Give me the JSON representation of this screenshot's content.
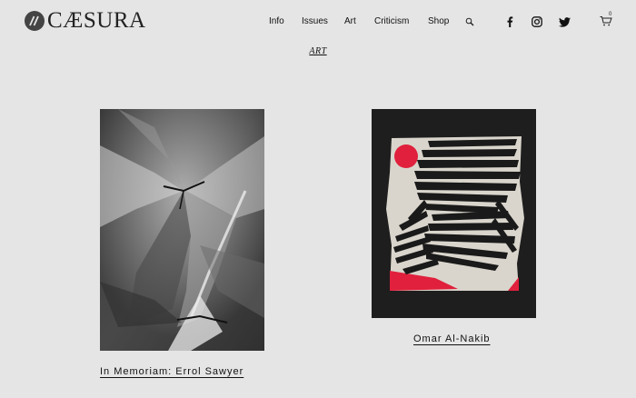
{
  "brand": {
    "name": "CÆSURA",
    "mark_text": "//"
  },
  "nav": {
    "items": [
      "Info",
      "Issues",
      "Art",
      "Criticism",
      "Shop"
    ]
  },
  "icons": [
    "search-icon",
    "facebook-icon",
    "instagram-icon",
    "twitter-icon",
    "cart-icon"
  ],
  "cart": {
    "count": "0"
  },
  "section": {
    "label": "ART"
  },
  "articles": [
    {
      "title": "In Memoriam: Errol Sawyer",
      "image": "black-and-white photograph of folded fabric"
    },
    {
      "title": "Omar Al-Nakib",
      "image": "abstract artwork with black stripes, red circle on black background"
    }
  ],
  "colors": {
    "background": "#e5e5e5",
    "text": "#111111",
    "accent_red": "#e0203c"
  }
}
